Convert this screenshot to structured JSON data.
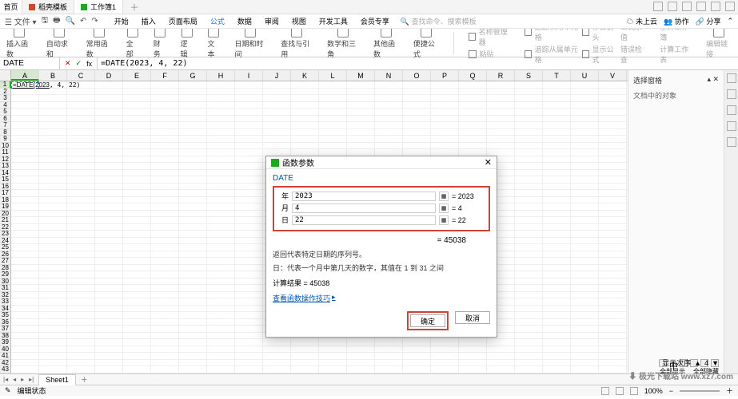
{
  "tabs": {
    "home": "首页",
    "template": "稻壳模板",
    "workbook": "工作簿1"
  },
  "menu": {
    "file": "文件",
    "start": "开始",
    "insert": "插入",
    "layout": "页面布局",
    "formula": "公式",
    "data": "数据",
    "review": "审阅",
    "view": "视图",
    "devtools": "开发工具",
    "member": "会员专享",
    "search_placeholder": "查找命令、搜索模板",
    "cloud": "未上云",
    "collab": "协作",
    "share": "分享"
  },
  "ribbon": {
    "g1": "插入函数",
    "g2": "自动求和",
    "g3": "常用函数",
    "g4": "全部",
    "g5": "财务",
    "g6": "逻辑",
    "g7": "文本",
    "g8": "日期和时间",
    "g9": "查找与引用",
    "g10": "数学和三角",
    "g11": "其他函数",
    "g12": "便捷公式",
    "r1": "名称管理器",
    "r2": "粘贴",
    "r3": "追踪引用单元格",
    "r4": "移去箭头",
    "r5": "追踪从属单元格",
    "r6": "显示公式",
    "r7": "公式求值",
    "r8": "错误检查",
    "r9": "重算工作簿",
    "r10": "计算工作表",
    "r11": "编辑链接"
  },
  "formula_bar": {
    "name_box": "DATE",
    "fx": "fx",
    "formula": "=DATE(2023, 4, 22)"
  },
  "columns": [
    "A",
    "B",
    "C",
    "D",
    "E",
    "F",
    "G",
    "H",
    "I",
    "J",
    "K",
    "L",
    "M",
    "N",
    "O",
    "P",
    "Q",
    "R",
    "S",
    "T",
    "U",
    "V"
  ],
  "cell_a1": "=DATE(2023, 4, 22)",
  "side_panel": {
    "title": "选择窗格",
    "empty": "文档中的对象"
  },
  "side_footer": {
    "show_all": "全部显示",
    "hide_all": "全部隐藏"
  },
  "side_counter": {
    "count": "4"
  },
  "dialog": {
    "title": "函数参数",
    "func": "DATE",
    "params": {
      "year_lbl": "年",
      "year_val": "2023",
      "year_res": "= 2023",
      "month_lbl": "月",
      "month_val": "4",
      "month_res": "= 4",
      "day_lbl": "日",
      "day_val": "22",
      "day_res": "= 22"
    },
    "eq_result": "= 45038",
    "desc1": "返回代表特定日期的序列号。",
    "desc2": "日：代表一个月中第几天的数字，其值在 1 到 31 之间",
    "calc_label": "计算结果 =",
    "calc_value": "45038",
    "help_link": "查看函数操作技巧",
    "ok": "确定",
    "cancel": "取消"
  },
  "sheet_tabs": {
    "sheet1": "Sheet1"
  },
  "status": {
    "mode": "编辑状态",
    "zoom": "100%"
  },
  "watermark": "⬇ 极光下载站 www.xz7.com",
  "pager": {
    "label": "显示次序"
  }
}
